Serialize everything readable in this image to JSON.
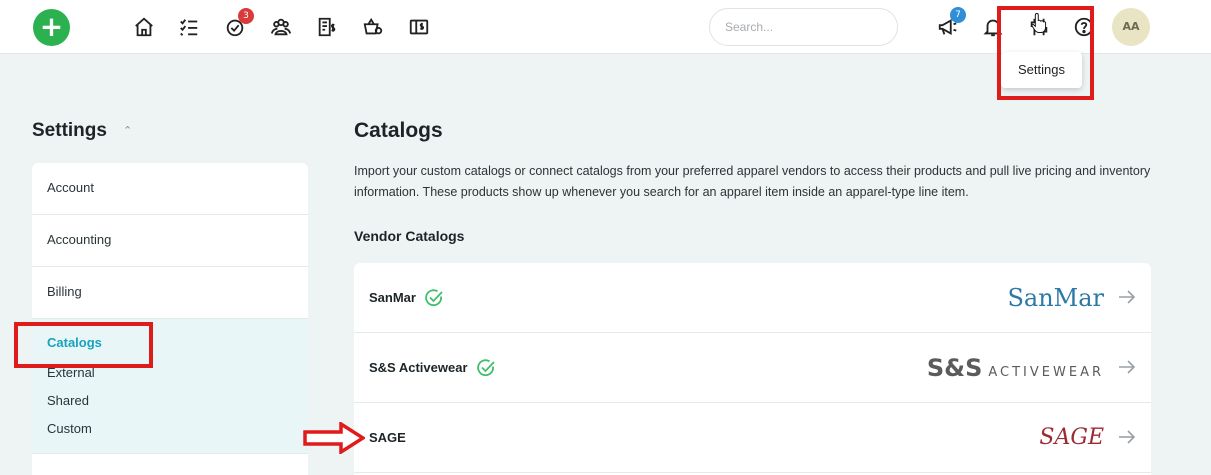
{
  "topbar": {
    "add_label": "+",
    "badges": {
      "tasks": "3",
      "announcements": "7"
    },
    "search_placeholder": "Search...",
    "avatar_initials": "AA",
    "icons": [
      "home-icon",
      "checklist-icon",
      "tasks-icon",
      "team-icon",
      "invoice-icon",
      "store-settings-icon",
      "wallet-icon",
      "megaphone-icon",
      "bell-icon",
      "settings-icon",
      "help-icon"
    ]
  },
  "tooltip": {
    "label": "Settings"
  },
  "sidebar": {
    "title": "Settings",
    "items": [
      {
        "label": "Account"
      },
      {
        "label": "Accounting"
      },
      {
        "label": "Billing"
      }
    ],
    "active": "Catalogs",
    "sub_items": [
      "External",
      "Shared",
      "Custom"
    ]
  },
  "main": {
    "title": "Catalogs",
    "description": "Import your custom catalogs or connect catalogs from your preferred apparel vendors to access their products and pull live pricing and inventory information. These products show up whenever you search for an apparel item inside an apparel-type line item.",
    "section_title": "Vendor Catalogs",
    "vendors": [
      {
        "name": "SanMar",
        "connected": true,
        "logo_text": "SanMar"
      },
      {
        "name": "S&S Activewear",
        "connected": true,
        "logo_text": "S&S",
        "logo_sub": "ACTIVEWEAR"
      },
      {
        "name": "SAGE",
        "connected": false,
        "logo_text": "SAGE"
      }
    ]
  },
  "colors": {
    "accent_green": "#2bb14f",
    "active_teal": "#1aa2bd",
    "highlight_red": "#e01b1b",
    "check_green": "#3fbf6a"
  }
}
